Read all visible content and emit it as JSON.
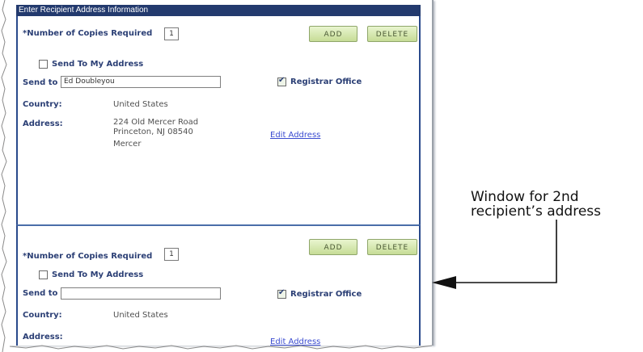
{
  "header": {
    "title": "Enter Recipient Address Information"
  },
  "recipient1": {
    "copies_label": "*Number of Copies Required",
    "copies_value": "1",
    "add_label": "ADD",
    "delete_label": "DELETE",
    "send_to_my_address_label": "Send To My Address",
    "send_to_label": "Send to",
    "send_to_value": "Ed Doubleyou",
    "registrar_office_label": "Registrar Office",
    "country_label": "Country:",
    "country_value": "United States",
    "address_label": "Address:",
    "address_line1": "224 Old Mercer Road",
    "address_line2": "Princeton, NJ 08540",
    "address_line3": "Mercer",
    "edit_address_label": "Edit Address"
  },
  "recipient2": {
    "copies_label": "*Number of Copies Required",
    "copies_value": "1",
    "add_label": "ADD",
    "delete_label": "DELETE",
    "send_to_my_address_label": "Send To My Address",
    "send_to_label": "Send to",
    "send_to_value": "",
    "registrar_office_label": "Registrar Office",
    "country_label": "Country:",
    "country_value": "United States",
    "address_label": "Address:",
    "edit_address_label": "Edit Address"
  },
  "annotation": {
    "line1": "Window for 2nd",
    "line2": "recipient’s address"
  },
  "colors": {
    "header_bg": "#233a6e",
    "label": "#2b3f75",
    "link": "#3a4bd0",
    "button_bg": "#c6dc96"
  }
}
